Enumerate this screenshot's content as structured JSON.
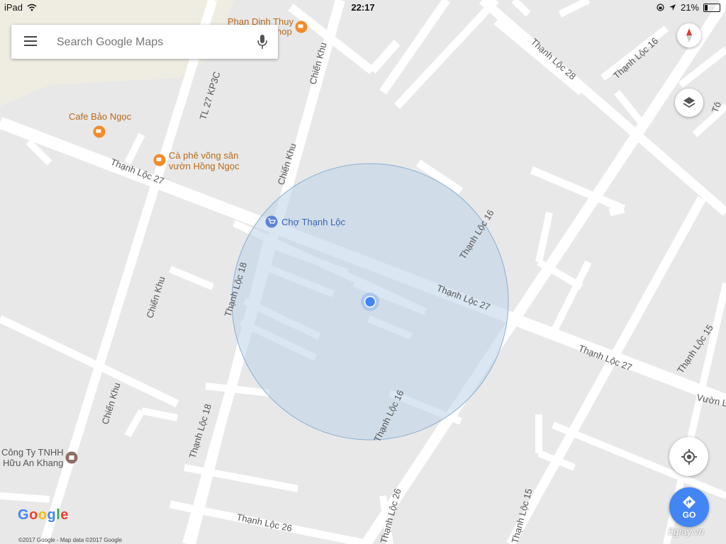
{
  "status_bar": {
    "device": "iPad",
    "time": "22:17",
    "battery_percent": "21%",
    "battery_level": 0.21
  },
  "search": {
    "placeholder": "Search Google Maps",
    "menu_icon": "hamburger-menu-icon",
    "mic_icon": "microphone-icon"
  },
  "map": {
    "street_labels": [
      "Thạnh Lộc 27",
      "Thạnh Lộc 27",
      "Thạnh Lộc 27",
      "Thạnh Lộc 18",
      "Thạnh Lộc 18",
      "Thạnh Lộc 16",
      "Thạnh Lộc 16",
      "Thạnh Lộc 16",
      "Thạnh Lộc 28",
      "Thạnh Lộc 26",
      "Thạnh Lộc 26",
      "Thạnh Lộc 15",
      "Thạnh Lộc 15",
      "Chiến Khu",
      "Chiến Khu",
      "Chiến Khu",
      "Chiến Khu",
      "TL 27 KP3C",
      "Vườn La",
      "Tô"
    ],
    "places": [
      {
        "name": "Phan Dinh Thuy",
        "name2": "hop",
        "icon": "cafe-icon"
      },
      {
        "name": "Cafe Bảo Ngọc",
        "icon": "cafe-icon"
      },
      {
        "name": "Cà phê võng sân",
        "name2": "vườn Hồng Ngọc",
        "icon": "cafe-icon"
      },
      {
        "name": "Chợ Thạnh Lộc",
        "icon": "shopping-cart-icon"
      },
      {
        "name": "Công Ty TNHH",
        "name2": "Hữu An Khang",
        "icon": "business-icon"
      }
    ],
    "colors": {
      "background": "#e8e8e8",
      "road": "#ffffff",
      "accuracy_circle": "#bcd3e8",
      "location_dot": "#4285f4",
      "poi_orange": "#f28c28",
      "poi_shop": "#5c84d6"
    }
  },
  "controls": {
    "compass_icon": "compass-icon",
    "layers_icon": "layers-icon",
    "locate_icon": "my-location-icon",
    "go_label": "GO",
    "go_icon": "directions-icon"
  },
  "footer": {
    "logo": "Google",
    "copyright": "©2017 Google - Map data ©2017 Google",
    "watermark": "5giay.vn"
  }
}
